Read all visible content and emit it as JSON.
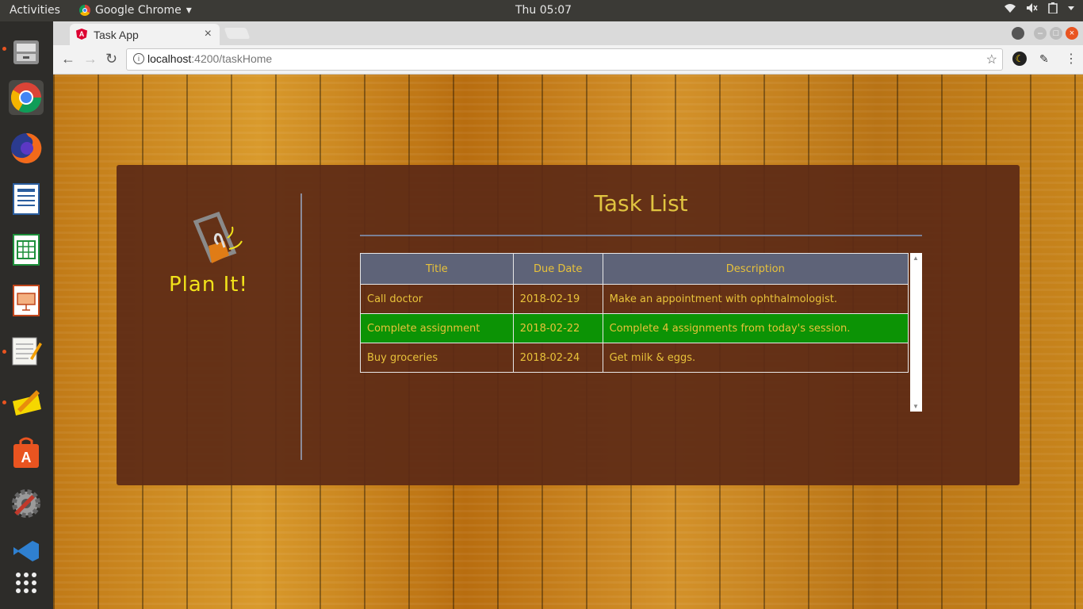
{
  "topbar": {
    "activities": "Activities",
    "app_name": "Google Chrome",
    "app_menu_arrow": "▾",
    "clock": "Thu 05:07",
    "tray": [
      "wifi-icon",
      "volume-icon",
      "battery-icon",
      "chevron-down-icon"
    ]
  },
  "dock": {
    "items": [
      "files",
      "chrome",
      "firefox",
      "writer",
      "calc",
      "impress",
      "text-editor",
      "notes",
      "software-center",
      "settings",
      "vscode"
    ],
    "show_apps": "⋮⋮⋮"
  },
  "browser": {
    "tab_title": "Task App",
    "tab_close": "×",
    "url_host": "localhost",
    "url_path": ":4200/taskHome",
    "info": "i",
    "star": "☆",
    "menu": "⋮",
    "back": "←",
    "forward": "→",
    "reload": "↻"
  },
  "app": {
    "logo_text": "Plan It!",
    "list_title": "Task List",
    "headers": [
      "Title",
      "Due Date",
      "Description"
    ],
    "tasks": [
      {
        "title": "Call doctor",
        "due": "2018-02-19",
        "description": "Make an appointment with ophthalmologist."
      },
      {
        "title": "Complete assignment",
        "due": "2018-02-22",
        "description": "Complete 4 assignments from today's session."
      },
      {
        "title": "Buy groceries",
        "due": "2018-02-24",
        "description": "Get milk & eggs."
      }
    ],
    "scroll_up": "▲",
    "scroll_down": "▼"
  },
  "colors": {
    "panel": "#5c2a16",
    "accent_text": "#e0c440",
    "highlight_row": "#0c9305",
    "header_bg": "#5e6378"
  }
}
